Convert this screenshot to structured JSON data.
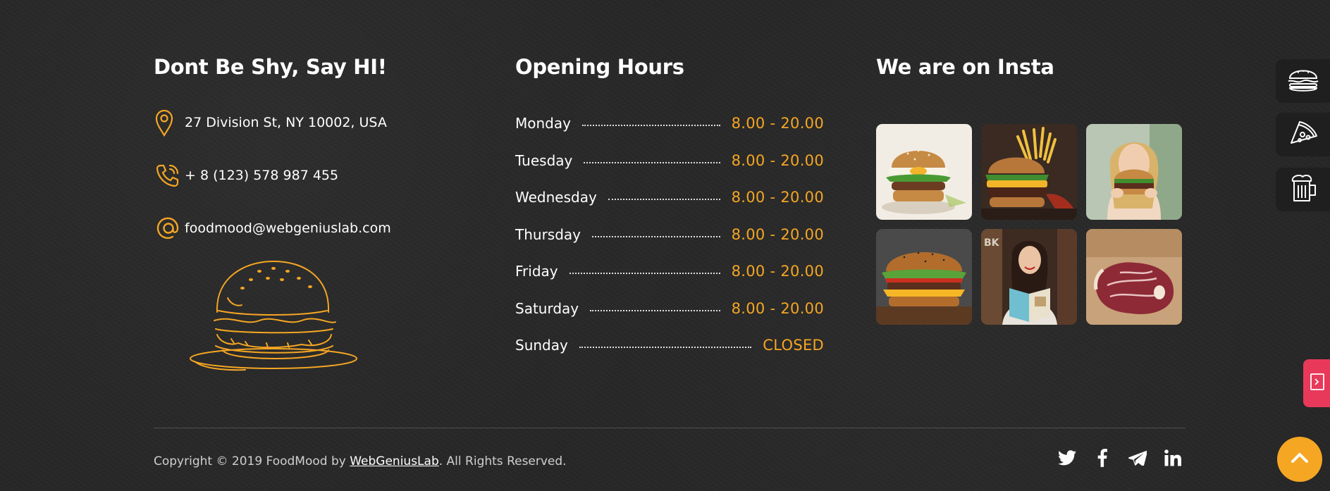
{
  "contact": {
    "title": "Dont Be Shy, Say HI!",
    "address": "27 Division St, NY 10002, USA",
    "phone": "+ 8 (123) 578 987 455",
    "email": "foodmood@webgeniuslab.com"
  },
  "hours": {
    "title": "Opening Hours",
    "rows": [
      {
        "day": "Monday",
        "time": "8.00 - 20.00"
      },
      {
        "day": "Tuesday",
        "time": "8.00 - 20.00"
      },
      {
        "day": "Wednesday",
        "time": "8.00 - 20.00"
      },
      {
        "day": "Thursday",
        "time": "8.00 - 20.00"
      },
      {
        "day": "Friday",
        "time": "8.00 - 20.00"
      },
      {
        "day": "Saturday",
        "time": "8.00 - 20.00"
      },
      {
        "day": "Sunday",
        "time": "CLOSED"
      }
    ]
  },
  "insta": {
    "title": "We are on Insta",
    "tiles": [
      "burger-egg-photo",
      "burger-fries-photo",
      "woman-eating-burger-photo",
      "cheeseburger-photo",
      "woman-reading-menu-photo",
      "raw-steak-photo"
    ]
  },
  "footer": {
    "copyright_prefix": "Copyright © 2019 FoodMood by ",
    "copyright_link": "WebGeniusLab",
    "copyright_suffix": ". All Rights Reserved.",
    "socials": [
      "twitter-icon",
      "facebook-icon",
      "telegram-icon",
      "linkedin-icon"
    ]
  },
  "side_tabs": [
    "burger-icon",
    "pizza-icon",
    "beer-icon"
  ],
  "colors": {
    "accent": "#f5a623",
    "background": "#272727",
    "pink": "#e8395a"
  }
}
